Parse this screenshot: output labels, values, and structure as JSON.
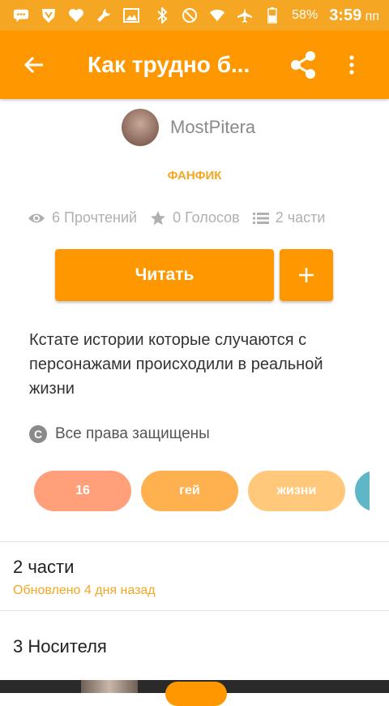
{
  "status_bar": {
    "battery_percent": "58%",
    "time": "3:59",
    "period": "пп",
    "icons": [
      "chat-icon",
      "vpn-icon",
      "heart-icon",
      "wrench-icon",
      "image-icon",
      "bluetooth-icon",
      "dnd-icon",
      "wifi-icon",
      "airplane-icon",
      "battery-icon"
    ]
  },
  "toolbar": {
    "title": "Как трудно б..."
  },
  "story": {
    "author": "MostPitera",
    "category": "ФАНФИК",
    "reads": "6 Прочтений",
    "votes": "0 Голосов",
    "parts": "2 части",
    "read_label": "Читать",
    "description": "Кстате истории которые случаются с персонажами происходили в реальной жизни",
    "rights": "Все права защищены",
    "tags": [
      {
        "label": "16",
        "color": "#ffa07a"
      },
      {
        "label": "гей",
        "color": "#ffb04f"
      },
      {
        "label": "жизни",
        "color": "#ffc87a"
      },
      {
        "label": "",
        "color": "#5fb6c6"
      }
    ]
  },
  "sections": {
    "parts_title": "2 части",
    "parts_updated": "Обновлено 4 дня назад",
    "carriers_title": "3 Носителя"
  },
  "colors": {
    "accent": "#ff9800",
    "status_bar": "#f5a623"
  }
}
